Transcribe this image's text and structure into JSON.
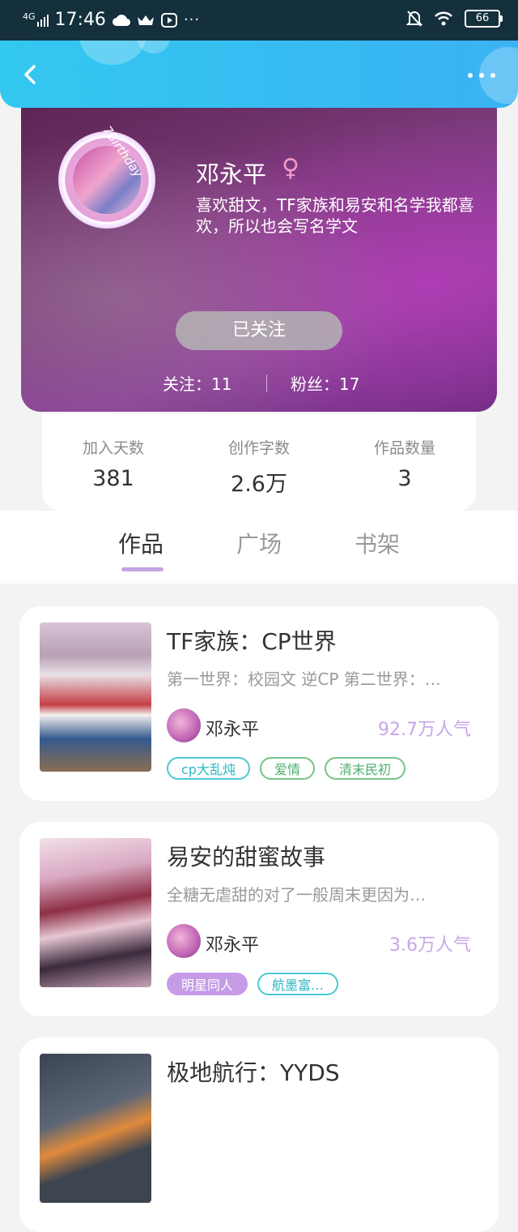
{
  "status_bar": {
    "network": "4G",
    "time": "17:46",
    "battery": "66"
  },
  "profile": {
    "avatar_text": "7Birthday",
    "name": "邓永平",
    "gender_symbol": "♀",
    "bio": "喜欢甜文，TF家族和易安和名学我都喜欢，所以也会写名学文",
    "follow_button": "已关注",
    "following_label": "关注：11",
    "fans_label": "粉丝：17"
  },
  "stats": [
    {
      "label": "加入天数",
      "value": "381"
    },
    {
      "label": "创作字数",
      "value": "2.6万"
    },
    {
      "label": "作品数量",
      "value": "3"
    }
  ],
  "tabs": [
    {
      "label": "作品",
      "active": true
    },
    {
      "label": "广场",
      "active": false
    },
    {
      "label": "书架",
      "active": false
    }
  ],
  "works": [
    {
      "title": "TF家族：CP世界",
      "desc": "第一世界：校园文 逆CP 第二世界：…",
      "author": "邓永平",
      "popularity": "92.7万人气",
      "tags": [
        {
          "label": "cp大乱炖",
          "style": "cyan"
        },
        {
          "label": "爱情",
          "style": "green"
        },
        {
          "label": "清末民初",
          "style": "green"
        }
      ]
    },
    {
      "title": "易安的甜蜜故事",
      "desc": "全糖无虐甜的对了一般周末更因为…",
      "author": "邓永平",
      "popularity": "3.6万人气",
      "tags": [
        {
          "label": "明星同人",
          "style": "filled"
        },
        {
          "label": "航墨富…",
          "style": "cyan"
        }
      ]
    },
    {
      "title": "极地航行：YYDS"
    }
  ],
  "colors": {
    "nav_gradient_start": "#33c8f0",
    "nav_gradient_end": "#3ab2f3",
    "accent_purple": "#c69ce7",
    "popularity": "#c7a6e9"
  }
}
